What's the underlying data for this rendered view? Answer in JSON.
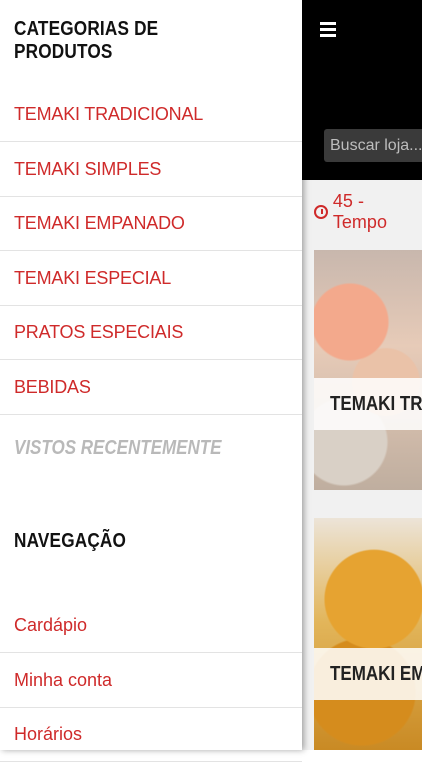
{
  "drawer": {
    "categories_title": "CATEGORIAS DE PRODUTOS",
    "categories": [
      {
        "label": "TEMAKI TRADICIONAL"
      },
      {
        "label": "TEMAKI SIMPLES"
      },
      {
        "label": "TEMAKI EMPANADO"
      },
      {
        "label": "TEMAKI ESPECIAL"
      },
      {
        "label": "PRATOS ESPECIAIS"
      },
      {
        "label": "BEBIDAS"
      }
    ],
    "recently_viewed_title": "VISTOS RECENTEMENTE",
    "navigation_title": "NAVEGAÇÃO",
    "navigation": [
      {
        "label": "Cardápio"
      },
      {
        "label": "Minha conta"
      },
      {
        "label": "Horários"
      }
    ]
  },
  "app": {
    "menu_icon": "hamburger-icon",
    "search_placeholder": "Buscar loja...",
    "delivery_time_text": "45 - Tempo",
    "clock_icon": "clock-icon",
    "cards": [
      {
        "label": "TEMAKI TRADICIONAL"
      },
      {
        "label": "TEMAKI EMPANADO"
      }
    ]
  },
  "colors": {
    "accent": "#cf2a2a",
    "header": "#000000"
  }
}
